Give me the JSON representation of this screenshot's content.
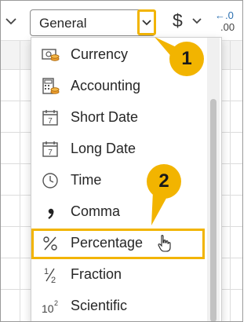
{
  "ribbon": {
    "number_format_value": "General",
    "currency_symbol": "$",
    "decimal_top": "←.0",
    "decimal_bottom": ".00"
  },
  "menu": {
    "items": [
      {
        "label": "Currency",
        "icon": "currency-icon"
      },
      {
        "label": "Accounting",
        "icon": "accounting-icon"
      },
      {
        "label": "Short Date",
        "icon": "calendar-icon"
      },
      {
        "label": "Long Date",
        "icon": "calendar-icon"
      },
      {
        "label": "Time",
        "icon": "clock-icon"
      },
      {
        "label": "Comma",
        "icon": "comma-icon"
      },
      {
        "label": "Percentage",
        "icon": "percent-icon"
      },
      {
        "label": "Fraction",
        "icon": "fraction-icon"
      },
      {
        "label": "Scientific",
        "icon": "scientific-icon"
      }
    ]
  },
  "callouts": {
    "step1": "1",
    "step2": "2"
  },
  "colors": {
    "highlight": "#f2b400",
    "scrollbar": "#c2c2c2"
  }
}
